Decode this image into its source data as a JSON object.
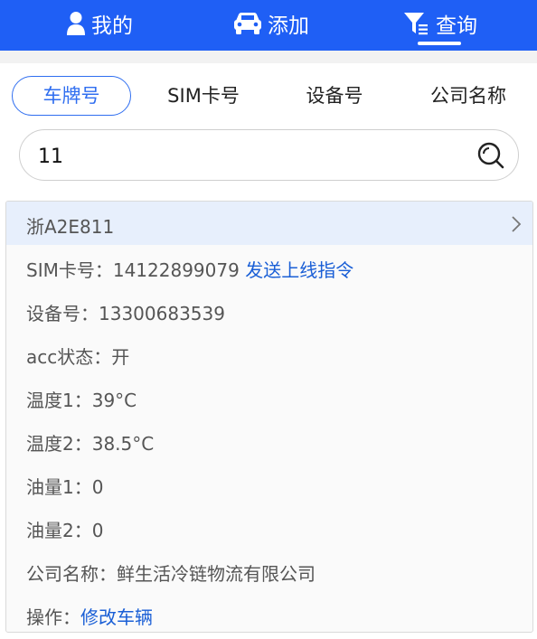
{
  "nav": {
    "me_label": "我的",
    "add_label": "添加",
    "query_label": "查询"
  },
  "tabs": [
    {
      "label": "车牌号"
    },
    {
      "label": "SIM卡号"
    },
    {
      "label": "设备号"
    },
    {
      "label": "公司名称"
    }
  ],
  "search": {
    "value": "11"
  },
  "vehicle": {
    "plate": "浙A2E811",
    "sim_label": "SIM卡号：",
    "sim_value": "14122899079",
    "send_online_cmd": "发送上线指令",
    "device_label": "设备号：",
    "device_value": "13300683539",
    "acc_label": "acc状态：",
    "acc_value": "开",
    "temp1_label": "温度1：",
    "temp1_value": "39°C",
    "temp2_label": "温度2：",
    "temp2_value": "38.5°C",
    "oil1_label": "油量1：",
    "oil1_value": "0",
    "oil2_label": "油量2：",
    "oil2_value": "0",
    "company_label": "公司名称：",
    "company_value": "鲜生活冷链物流有限公司",
    "op_label": "操作：",
    "edit_vehicle": "修改车辆"
  },
  "colors": {
    "primary": "#1f5ff5",
    "link": "#1a5fd6",
    "card_head": "#e7effc"
  }
}
